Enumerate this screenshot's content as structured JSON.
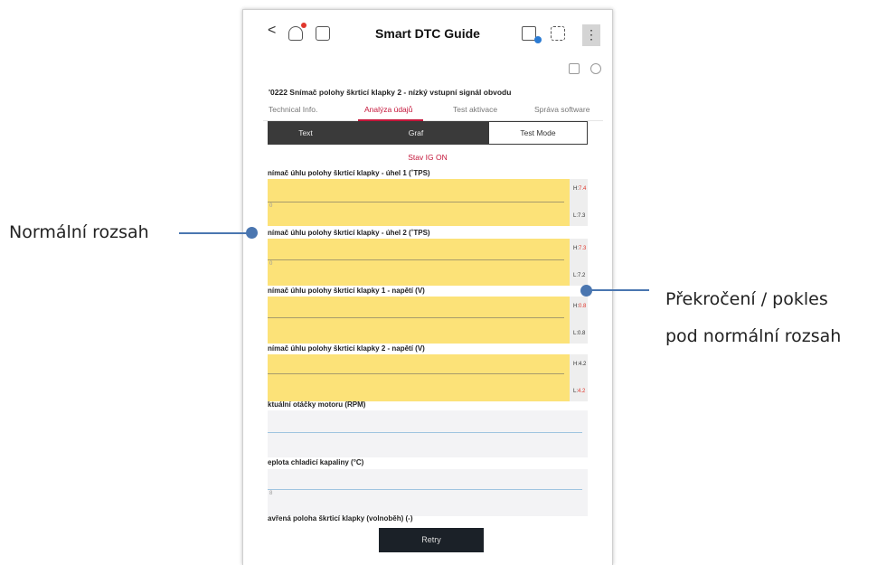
{
  "app": {
    "title": "Smart DTC Guide",
    "back": "<",
    "menu": "⋮"
  },
  "dtc_title": "'0222 Snímač polohy škrticí klapky 2 - nízký vstupní signál obvodu",
  "tabs": [
    {
      "label": "Technical Info."
    },
    {
      "label": "Analýza údajů",
      "active": true
    },
    {
      "label": "Test aktivace"
    },
    {
      "label": "Správa software"
    }
  ],
  "view_modes": [
    {
      "label": "Text"
    },
    {
      "label": "Graf"
    },
    {
      "label": "Test Mode"
    }
  ],
  "state_label": "Stav IG ON",
  "panels": [
    {
      "label": "nímač úhlu polohy škrticí klapky - úhel 1 (˚TPS)",
      "zero": "0",
      "h_label": "H:",
      "h_value": "7.4",
      "l_label": "L:",
      "l_value": "7.3",
      "h_out": true,
      "l_out": false
    },
    {
      "label": "nímač úhlu polohy škrticí klapky - úhel 2 (˚TPS)",
      "zero": "0",
      "h_label": "H:",
      "h_value": "7.3",
      "l_label": "L:",
      "l_value": "7.2",
      "h_out": true,
      "l_out": false
    },
    {
      "label": "nímač úhlu polohy škrticí klapky 1 - napětí (V)",
      "zero": "",
      "h_label": "H:",
      "h_value": "0.8",
      "l_label": "L:",
      "l_value": "0.8",
      "h_out": true,
      "l_out": false
    },
    {
      "label": "nímač úhlu polohy škrticí klapky 2 - napětí (V)",
      "zero": "",
      "h_label": "H:",
      "h_value": "4.2",
      "l_label": "L:",
      "l_value": "4.2",
      "h_out": false,
      "l_out": true
    }
  ],
  "plain_panels": [
    {
      "label": "ktuální otáčky motoru (RPM)",
      "zero": ""
    },
    {
      "label": "eplota chladicí kapaliny (°C)",
      "zero": "8"
    }
  ],
  "last_label": "avřená poloha škrticí klapky (volnoběh) (-)",
  "retry_label": "Retry",
  "callouts": {
    "normal_range": "Normální rozsah",
    "out_of_range_line1": "Překročení / pokles",
    "out_of_range_line2": "pod normální rozsah"
  },
  "colors": {
    "accent": "#c4163a",
    "in_range": "#fce278",
    "out_of_range_value": "#e0362c",
    "callout": "#4a76b0"
  }
}
